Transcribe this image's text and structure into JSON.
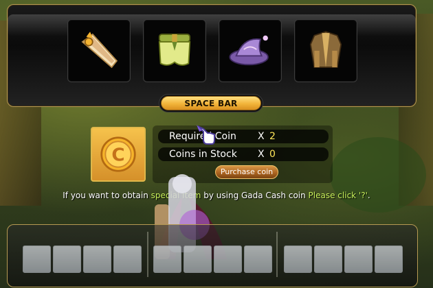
{
  "items": [
    {
      "icon": "golden-blade-icon",
      "color": "#e7c488"
    },
    {
      "icon": "green-armor-shorts-icon",
      "color": "#b7c24a"
    },
    {
      "icon": "purple-witch-hat-icon",
      "color": "#9a76c9"
    },
    {
      "icon": "brown-coat-icon",
      "color": "#8b6a3a"
    }
  ],
  "space_bar_label": "SPACE BAR",
  "coin": {
    "icon_letter": "C",
    "required_label": "Required Coin",
    "required_x": "X",
    "required_value": "2",
    "stock_label": "Coins in Stock",
    "stock_x": "X",
    "stock_value": "0",
    "purchase_label": "Purchase coin"
  },
  "notice": {
    "part1": "If you want to obtain ",
    "highlight1": "special item",
    "part2": " by using Gada Cash coin ",
    "highlight2": "Please click '?'",
    "part3": "."
  },
  "inventory": {
    "group1_slots": 4,
    "group2_slots": 4,
    "group3_slots": 4
  },
  "colors": {
    "gold_border": "#b79a53",
    "highlight_text": "#c8f05a",
    "value_text": "#ffe65a"
  }
}
